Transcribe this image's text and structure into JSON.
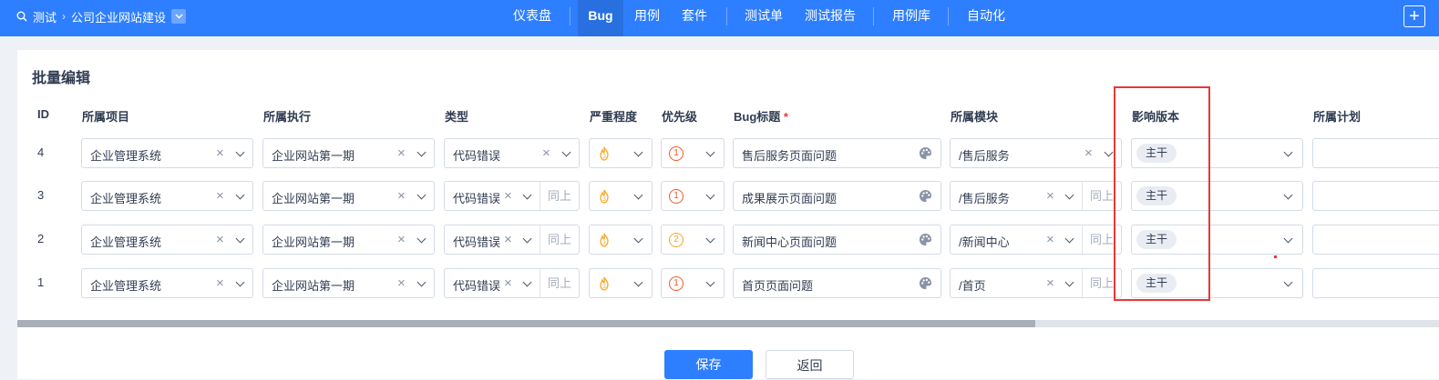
{
  "breadcrumb": {
    "root": "测试",
    "product": "公司企业网站建设"
  },
  "nav": [
    "仪表盘",
    "Bug",
    "用例",
    "套件",
    "测试单",
    "测试报告",
    "用例库",
    "自动化"
  ],
  "nav_active": "Bug",
  "page_title": "批量编辑",
  "columns": {
    "id": "ID",
    "project": "所属项目",
    "execution": "所属执行",
    "type": "类型",
    "severity": "严重程度",
    "priority": "优先级",
    "bug_title": "Bug标题",
    "module": "所属模块",
    "version": "影响版本",
    "plan": "所属计划"
  },
  "required_mark": "*",
  "same_as_above": "同上",
  "rows": [
    {
      "id": "4",
      "project": "企业管理系统",
      "execution": "企业网站第一期",
      "type": "代码错误",
      "priority": "1",
      "title": "售后服务页面问题",
      "module": "/售后服务",
      "version": "主干"
    },
    {
      "id": "3",
      "project": "企业管理系统",
      "execution": "企业网站第一期",
      "type": "代码错误",
      "priority": "1",
      "title": "成果展示页面问题",
      "module": "/售后服务",
      "version": "主干"
    },
    {
      "id": "2",
      "project": "企业管理系统",
      "execution": "企业网站第一期",
      "type": "代码错误",
      "priority": "2",
      "title": "新闻中心页面问题",
      "module": "/新闻中心",
      "version": "主干"
    },
    {
      "id": "1",
      "project": "企业管理系统",
      "execution": "企业网站第一期",
      "type": "代码错误",
      "priority": "1",
      "title": "首页页面问题",
      "module": "/首页",
      "version": "主干"
    }
  ],
  "buttons": {
    "save": "保存",
    "back": "返回"
  },
  "colors": {
    "brand": "#2e7fff",
    "highlight": "#e53935",
    "priority_1": "#f0592b",
    "priority_2": "#f5a623",
    "severity": "#f5a623"
  }
}
